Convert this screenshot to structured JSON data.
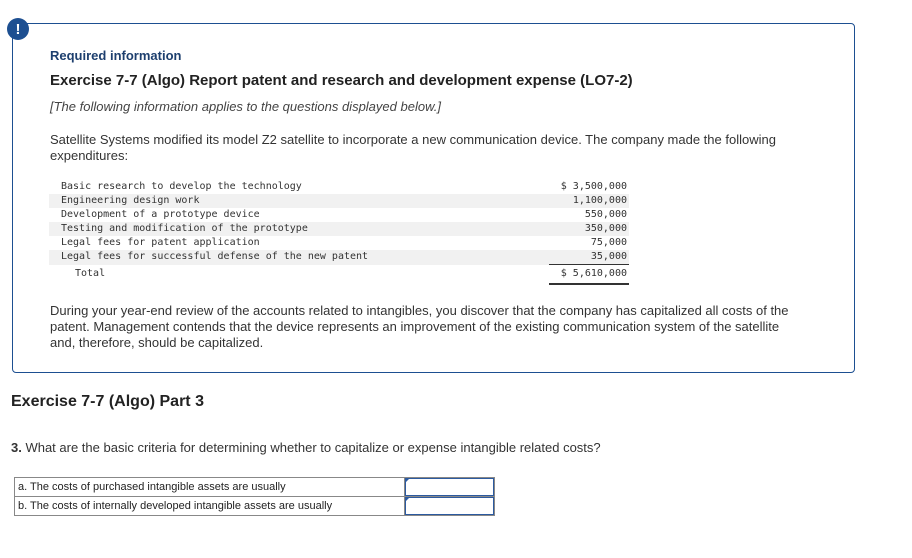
{
  "alert_icon": "!",
  "required_label": "Required information",
  "exercise_title": "Exercise 7-7 (Algo) Report patent and research and development expense (LO7-2)",
  "note": "[The following information applies to the questions displayed below.]",
  "intro": "Satellite Systems modified its model Z2 satellite to incorporate a new communication device. The company made the following expenditures:",
  "expenditures": [
    {
      "label": "Basic research to develop the technology",
      "amount": "$ 3,500,000"
    },
    {
      "label": "Engineering design work",
      "amount": "1,100,000"
    },
    {
      "label": "Development of a prototype device",
      "amount": "550,000"
    },
    {
      "label": "Testing and modification of the prototype",
      "amount": "350,000"
    },
    {
      "label": "Legal fees for patent application",
      "amount": "75,000"
    },
    {
      "label": "Legal fees for successful defense of the new patent",
      "amount": "35,000"
    }
  ],
  "total": {
    "label": "Total",
    "amount": "$ 5,610,000"
  },
  "review_paragraph": "During your year-end review of the accounts related to intangibles, you discover that the company has capitalized all costs of the patent. Management contends that the device represents an improvement of the existing communication system of the satellite and, therefore, should be capitalized.",
  "part_title": "Exercise 7-7 (Algo) Part 3",
  "question_number": "3.",
  "question_text": " What are the basic criteria for determining whether to capitalize or expense intangible related costs?",
  "answer_rows": [
    {
      "label": "a. The costs of purchased intangible assets are usually",
      "value": ""
    },
    {
      "label": "b. The costs of internally developed intangible assets are usually",
      "value": ""
    }
  ]
}
